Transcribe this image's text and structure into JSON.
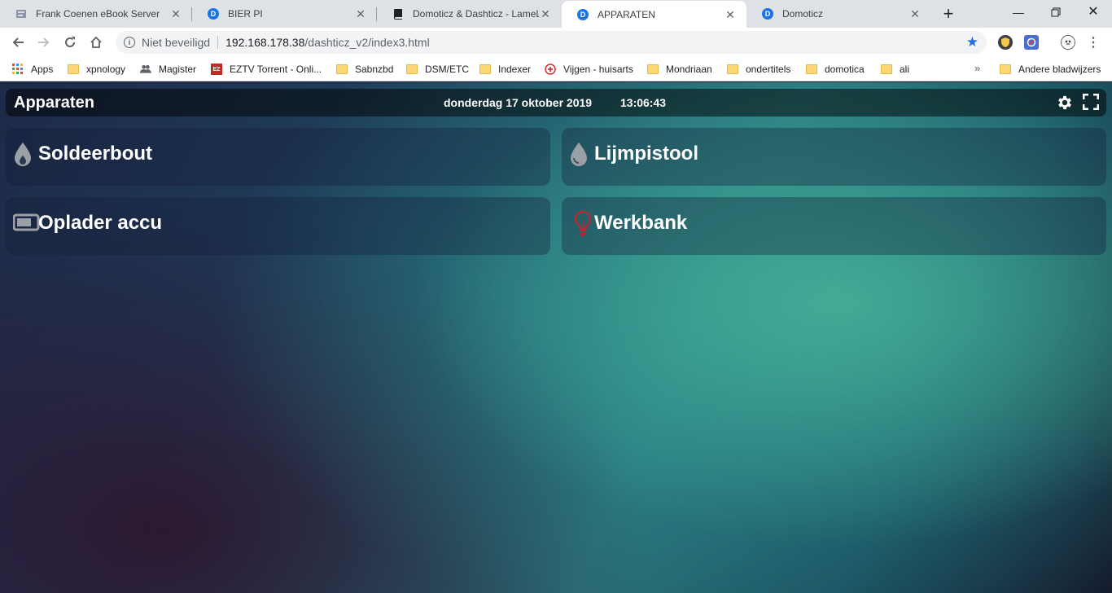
{
  "browser": {
    "tabs": [
      {
        "title": "Frank Coenen eBook Server",
        "icon": "ebook-server-icon",
        "active": false
      },
      {
        "title": "BIER PI",
        "icon": "domoticz-icon",
        "active": false
      },
      {
        "title": "Domoticz & Dashticz - LameLo",
        "icon": "book-icon",
        "active": false
      },
      {
        "title": "APPARATEN",
        "icon": "domoticz-icon",
        "active": true
      },
      {
        "title": "Domoticz",
        "icon": "domoticz-icon",
        "active": false
      }
    ],
    "address": {
      "security_label": "Niet beveiligd",
      "host": "192.168.178.38",
      "path": "/dashticz_v2/index3.html"
    },
    "bookmarks": [
      {
        "label": "Apps",
        "icon": "apps-grid-icon"
      },
      {
        "label": "xpnology",
        "icon": "folder-icon"
      },
      {
        "label": "Magister",
        "icon": "people-icon"
      },
      {
        "label": "EZTV Torrent - Onli...",
        "icon": "eztv-icon"
      },
      {
        "label": "Sabnzbd",
        "icon": "folder-icon"
      },
      {
        "label": "DSM/ETC",
        "icon": "folder-icon"
      },
      {
        "label": "Indexer",
        "icon": "folder-icon"
      },
      {
        "label": "Vijgen - huisarts",
        "icon": "medical-cross-icon"
      },
      {
        "label": "Mondriaan",
        "icon": "folder-icon"
      },
      {
        "label": "ondertitels",
        "icon": "folder-icon"
      },
      {
        "label": "domotica",
        "icon": "folder-icon"
      },
      {
        "label": "ali",
        "icon": "folder-icon"
      }
    ],
    "bookmarks_overflow": "»",
    "other_bookmarks": "Andere bladwijzers"
  },
  "dashboard": {
    "title": "Apparaten",
    "date": "donderdag 17 oktober 2019",
    "time": "13:06:43",
    "tiles": [
      {
        "label": "Soldeerbout",
        "icon": "flame-drop-icon"
      },
      {
        "label": "Lijmpistool",
        "icon": "drop-icon"
      },
      {
        "label": "Oplader accu",
        "icon": "battery-icon"
      },
      {
        "label": "Werkbank",
        "icon": "lightbulb-icon"
      }
    ]
  },
  "colors": {
    "header_bg": "#000000",
    "tile_text": "#ffffff",
    "bulb": "#c0262f",
    "icon_gray": "#9aa0a6",
    "accent": "#1a73e8"
  }
}
